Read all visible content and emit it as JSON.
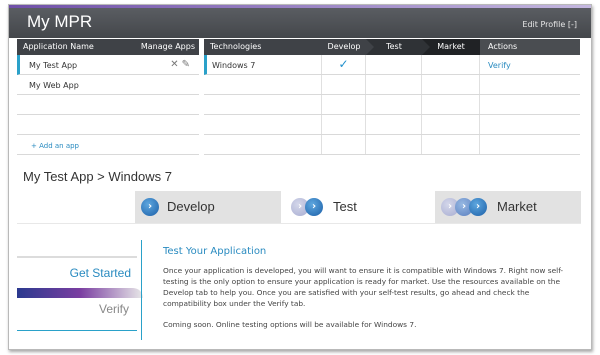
{
  "header": {
    "title": "My MPR",
    "edit_label": "Edit Profile [-]"
  },
  "apps_table": {
    "col_name": "Application Name",
    "col_manage": "Manage Apps",
    "rows": [
      {
        "name": "My Test App",
        "selected": true
      },
      {
        "name": "My Web App",
        "selected": false
      }
    ],
    "add_label": "+ Add an app"
  },
  "tech_table": {
    "headers": [
      "Technologies",
      "Develop",
      "Test",
      "Market",
      "Actions"
    ],
    "rows": [
      {
        "tech": "Windows 7",
        "develop_done": "✓",
        "action": "Verify"
      }
    ]
  },
  "breadcrumb": "My Test App > Windows 7",
  "tabs": {
    "develop": "Develop",
    "test": "Test",
    "market": "Market"
  },
  "side_nav": {
    "get_started": "Get Started",
    "verify": "Verify"
  },
  "content": {
    "title": "Test Your Application",
    "body": "Once your application is developed, you will want to ensure it is compatible with Windows 7.  Right now self-testing is the only option to ensure your application is ready for market.  Use the resources available on the Develop tab to help you.  Once you are satisfied with your self-test results, go ahead and check the compatibility box under the Verify tab.",
    "coming_soon": "Coming soon.  Online testing options will be available for Windows 7."
  },
  "colors": {
    "accent": "#2a8bc0",
    "header_bg": "#44474b",
    "tab_inactive": "#e2e2e2"
  }
}
